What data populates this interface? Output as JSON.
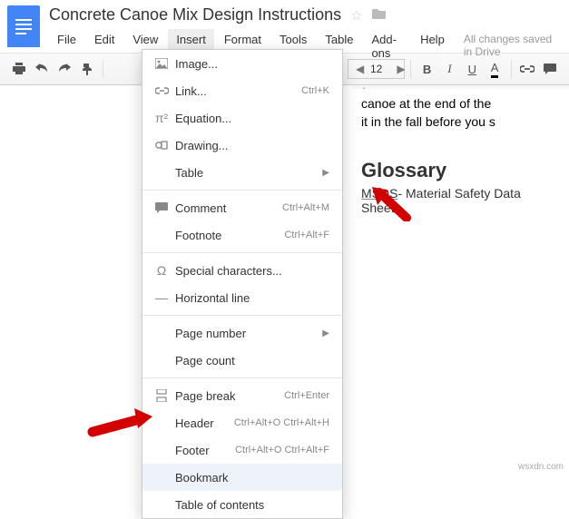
{
  "doc": {
    "title": "Concrete Canoe Mix Design Instructions",
    "save_status": "All changes saved in Drive"
  },
  "menubar": {
    "file": "File",
    "edit": "Edit",
    "view": "View",
    "insert": "Insert",
    "format": "Format",
    "tools": "Tools",
    "table": "Table",
    "addons": "Add-ons",
    "help": "Help"
  },
  "toolbar": {
    "font_size": "12"
  },
  "dropdown": {
    "image": "Image...",
    "link": "Link...",
    "link_sc": "Ctrl+K",
    "equation": "Equation...",
    "drawing": "Drawing...",
    "table": "Table",
    "comment": "Comment",
    "comment_sc": "Ctrl+Alt+M",
    "footnote": "Footnote",
    "footnote_sc": "Ctrl+Alt+F",
    "special": "Special characters...",
    "hr": "Horizontal line",
    "pagenum": "Page number",
    "pagecount": "Page count",
    "pagebreak": "Page break",
    "pagebreak_sc": "Ctrl+Enter",
    "header": "Header",
    "header_sc": "Ctrl+Alt+O Ctrl+Alt+H",
    "footer": "Footer",
    "footer_sc": "Ctrl+Alt+O Ctrl+Alt+F",
    "bookmark": "Bookmark",
    "toc": "Table of contents"
  },
  "document": {
    "line1": "canoe at the end of the",
    "line2": "it in the fall before you s",
    "glossary_heading": "Glossary",
    "msd_key": "MSDS",
    "msd_sep": "- ",
    "msd_val": "Material Safety Data Sheets"
  },
  "watermark": "wsxdn.com"
}
